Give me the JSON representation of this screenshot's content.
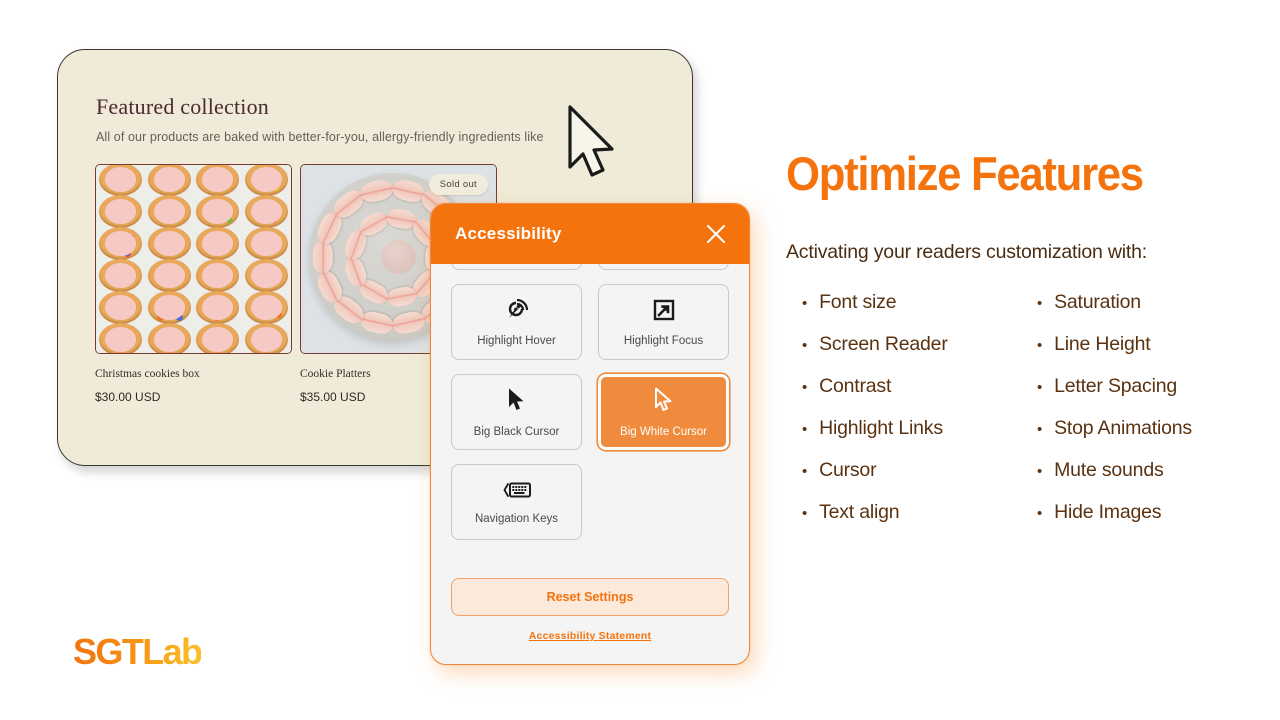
{
  "storefront": {
    "heading": "Featured collection",
    "subheading": "All of our products are baked with better-for-you, allergy-friendly ingredients like",
    "products": [
      {
        "name": "Christmas cookies box",
        "price": "$30.00 USD",
        "badge": ""
      },
      {
        "name": "Cookie Platters",
        "price": "$35.00 USD",
        "badge": "Sold out"
      }
    ],
    "cursor_icon": "big-white-cursor"
  },
  "accessibility_panel": {
    "title": "Accessibility",
    "close_icon": "close-icon",
    "tiles": [
      {
        "label": "Highlight Hover",
        "icon": "highlight-hover-icon",
        "selected": false
      },
      {
        "label": "Highlight Focus",
        "icon": "highlight-focus-icon",
        "selected": false
      },
      {
        "label": "Big Black Cursor",
        "icon": "black-cursor-icon",
        "selected": false
      },
      {
        "label": "Big White Cursor",
        "icon": "white-cursor-icon",
        "selected": true
      },
      {
        "label": "Navigation Keys",
        "icon": "keyboard-icon",
        "selected": false
      }
    ],
    "reset_label": "Reset Settings",
    "statement_label": "Accessibility Statement",
    "accent_color": "#F4730D",
    "selected_color": "#F08A3C"
  },
  "content": {
    "headline": "Optimize Features",
    "lead": "Activating your readers customization with:",
    "features_left": [
      "Font size",
      "Screen Reader",
      "Contrast",
      "Highlight Links",
      "Cursor",
      "Text align"
    ],
    "features_right": [
      "Saturation",
      "Line Height",
      "Letter Spacing",
      "Stop Animations",
      "Mute sounds",
      "Hide Images"
    ],
    "bullet_glyph": "•"
  },
  "brand": {
    "logo_text": "SGTLab"
  }
}
